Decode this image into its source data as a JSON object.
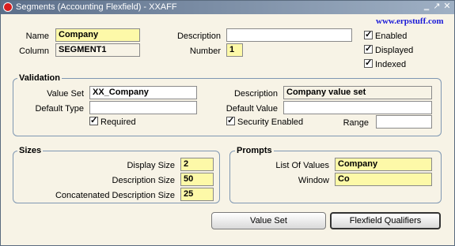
{
  "window": {
    "title": "Segments (Accounting Flexfield) - XXAFF",
    "watermark": "www.erpstuff.com"
  },
  "segment": {
    "name_label": "Name",
    "name_value": "Company",
    "column_label": "Column",
    "column_value": "SEGMENT1",
    "description_label": "Description",
    "description_value": "",
    "number_label": "Number",
    "number_value": "1",
    "enabled_label": "Enabled",
    "displayed_label": "Displayed",
    "indexed_label": "Indexed"
  },
  "validation": {
    "title": "Validation",
    "value_set_label": "Value Set",
    "value_set_value": "XX_Company",
    "description_label": "Description",
    "description_value": "Company value set",
    "default_type_label": "Default Type",
    "default_type_value": "",
    "default_value_label": "Default Value",
    "default_value_value": "",
    "required_label": "Required",
    "security_label": "Security Enabled",
    "range_label": "Range",
    "range_value": ""
  },
  "sizes": {
    "title": "Sizes",
    "display_label": "Display Size",
    "display_value": "2",
    "description_label": "Description Size",
    "description_value": "50",
    "concat_label": "Concatenated Description Size",
    "concat_value": "25"
  },
  "prompts": {
    "title": "Prompts",
    "lov_label": "List Of Values",
    "lov_value": "Company",
    "window_label": "Window",
    "window_value": "Co"
  },
  "buttons": {
    "value_set": "Value Set",
    "flexfield_qualifiers": "Flexfield Qualifiers"
  }
}
